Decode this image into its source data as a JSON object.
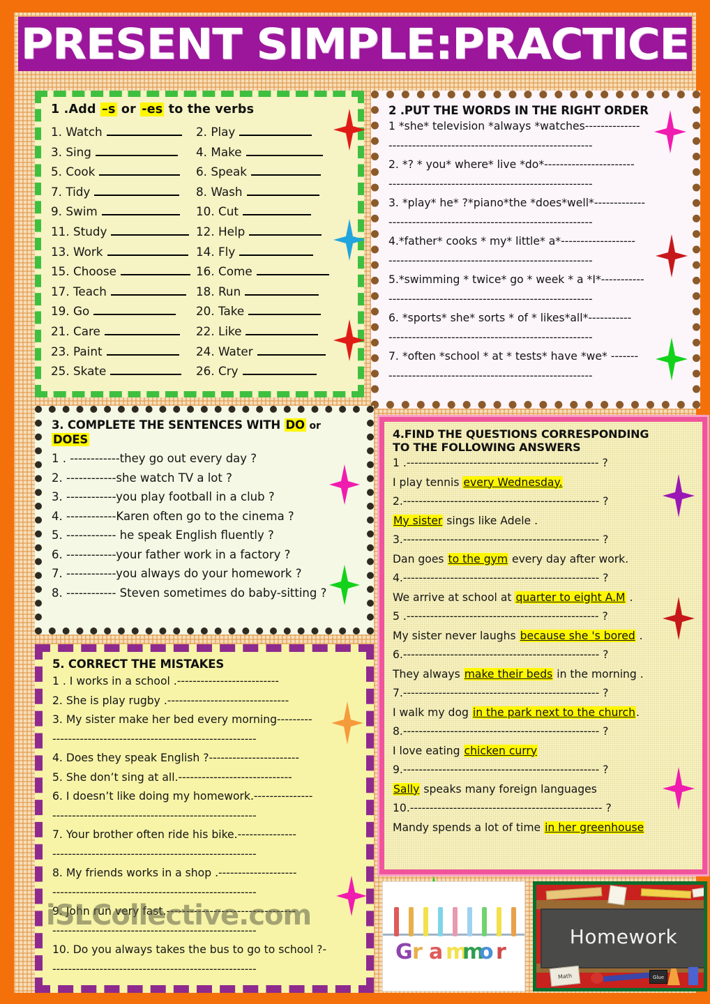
{
  "title": "PRESENT SIMPLE:PRACTICE",
  "colors": {
    "page_border": "#F4700B",
    "title_banner": "#9B169B",
    "highlight": "#FFF700",
    "box1_border": "#3FBF3F",
    "box2_border": "#8B5A2B",
    "box3_border": "#2E2A21",
    "box4_border": "#F0559B",
    "box5_border": "#8E2A8E"
  },
  "exercise1": {
    "heading_prefix": "1 .Add ",
    "heading_s": "–s",
    "heading_mid": " or ",
    "heading_es": "-es",
    "heading_suffix": " to the verbs",
    "verbs": [
      "1. Watch",
      "2. Play",
      "3. Sing",
      "4. Make",
      "5. Cook",
      "6. Speak",
      "7. Tidy",
      "8. Wash",
      "9. Swim",
      "10. Cut",
      "11. Study",
      "12. Help",
      "13. Work",
      "14. Fly",
      "15. Choose",
      "16. Come",
      "17. Teach",
      "18. Run",
      "19. Go",
      "20. Take",
      "21. Care",
      "22. Like",
      "23. Paint",
      "24. Water",
      "25. Skate",
      "26. Cry"
    ]
  },
  "exercise2": {
    "heading": "2 .PUT THE WORDS IN THE RIGHT ORDER",
    "items": [
      "1 *she* television *always *watches--------------",
      "----------------------------------------------------",
      "2. *? * you* where* live *do*-----------------------",
      "----------------------------------------------------",
      "3. *play* he* ?*piano*the *does*well*-------------",
      "----------------------------------------------------",
      "4.*father* cooks * my* little* a*-------------------",
      "----------------------------------------------------",
      "5.*swimming * twice* go * week * a *I*-----------",
      "----------------------------------------------------",
      "6. *sports* she* sorts * of * likes*all*-----------",
      "----------------------------------------------------",
      "7. *often *school * at * tests* have *we* -------",
      "----------------------------------------------------"
    ]
  },
  "exercise3": {
    "heading_prefix": "3. COMPLETE THE SENTENCES WITH ",
    "heading_do": "DO",
    "heading_or": " or",
    "heading_does": "DOES",
    "items": [
      "1 . ------------they go out every day ?",
      "2. ------------she watch TV a lot ?",
      "3. ------------you play football in a club ?",
      "4. ------------Karen often go to the cinema ?",
      "5. ------------ he speak English fluently ?",
      "6. ------------your father work in a factory ?",
      "7. ------------you always do your homework ?",
      "8. ------------ Steven sometimes do baby-sitting ?"
    ]
  },
  "exercise4": {
    "heading_line1": "4.FIND THE QUESTIONS CORRESPONDING",
    "heading_line2": "TO THE FOLLOWING ANSWERS",
    "pairs": [
      {
        "q": "1 .------------------------------------------------- ?",
        "a_pre": "I play tennis ",
        "a_hl": "every Wednesday.",
        "a_post": ""
      },
      {
        "q": "2.-------------------------------------------------- ?",
        "a_pre": "",
        "a_hl": "My sister",
        "a_post": " sings like Adele    ."
      },
      {
        "q": "3.-------------------------------------------------- ?",
        "a_pre": "Dan goes ",
        "a_hl": "to the gym",
        "a_post": " every day after work."
      },
      {
        "q": "4.-------------------------------------------------- ?",
        "a_pre": "We arrive at school at ",
        "a_hl": "quarter to eight A.M",
        "a_post": " ."
      },
      {
        "q": "5 .------------------------------------------------- ?",
        "a_pre": "My sister never laughs ",
        "a_hl": "because she 's bored",
        "a_post": " ."
      },
      {
        "q": "6.-------------------------------------------------- ?",
        "a_pre": "They always ",
        "a_hl": "make their beds",
        "a_post": " in the morning   ."
      },
      {
        "q": "7.-------------------------------------------------- ?",
        "a_pre": "I walk my dog ",
        "a_hl": "in the park next to the church",
        "a_post": "."
      },
      {
        "q": "8.-------------------------------------------------- ?",
        "a_pre": "I love eating ",
        "a_hl": "chicken curry",
        "a_post": ""
      },
      {
        "q": "9.-------------------------------------------------- ?",
        "a_pre": "",
        "a_hl": "Sally",
        "a_post": " speaks many foreign languages"
      },
      {
        "q": "10.------------------------------------------------- ?",
        "a_pre": "Mandy spends a lot of time ",
        "a_hl": "in her greenhouse",
        "a_post": ""
      }
    ]
  },
  "exercise5": {
    "heading": "5. CORRECT THE MISTAKES",
    "items": [
      "1 . I works in a school    .--------------------------",
      "2. She is  play rugby .-------------------------------",
      "3. My sister make her bed every morning---------",
      "----------------------------------------------------",
      "4. Does they speak English ?-----------------------",
      "5. She don’t  sing at all.-----------------------------",
      "6. I doesn’t like doing my homework.---------------",
      "----------------------------------------------------",
      "7. Your brother often ride his bike.---------------",
      "----------------------------------------------------",
      "8. My friends works in a shop .--------------------",
      "----------------------------------------------------",
      "9. John run very fast.---------------------------------",
      "----------------------------------------------------",
      "10. Do you always takes the bus to go to school ?-",
      "----------------------------------------------------"
    ]
  },
  "images": {
    "grammar_letters": [
      "G",
      "r",
      "a",
      "m",
      "m",
      "o",
      "r"
    ],
    "homework_label": "Homework",
    "math_book_label": "Math",
    "glue_label": "Glue"
  },
  "watermark": "iSLCollective.com"
}
